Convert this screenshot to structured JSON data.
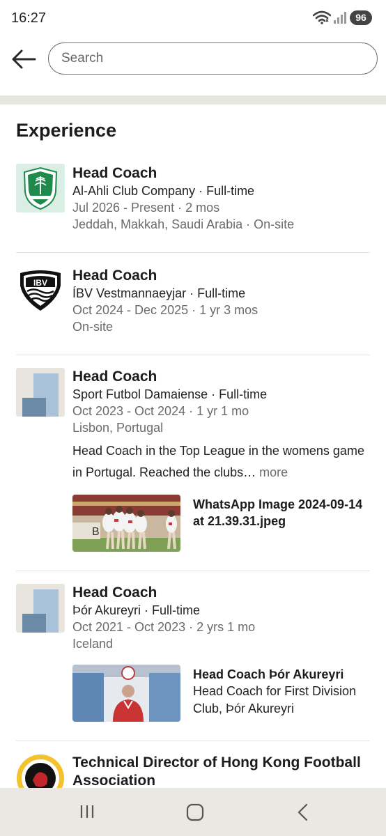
{
  "status": {
    "time": "16:27",
    "battery": "96"
  },
  "search": {
    "placeholder": "Search"
  },
  "section": {
    "title": "Experience"
  },
  "experiences": [
    {
      "role": "Head Coach",
      "company": "Al-Ahli Club Company · Full-time",
      "dates": "Jul 2026 - Present · 2 mos",
      "location": "Jeddah, Makkah, Saudi Arabia · On-site"
    },
    {
      "role": "Head Coach",
      "company": "ÍBV Vestmannaeyjar · Full-time",
      "dates": "Oct 2024 - Dec 2025 · 1 yr 3 mos",
      "location": "On-site"
    },
    {
      "role": "Head Coach",
      "company": "Sport Futbol Damaiense · Full-time",
      "dates": "Oct 2023 - Oct 2024 · 1 yr 1 mo",
      "location": "Lisbon, Portugal",
      "description": "Head Coach in the Top League in the womens game in Portugal. Reached the clubs…",
      "more": "more",
      "media": {
        "title": "WhatsApp Image 2024-09-14 at 21.39.31.jpeg"
      }
    },
    {
      "role": "Head Coach",
      "company": "Þór Akureyri · Full-time",
      "dates": "Oct 2021 - Oct 2023 · 2 yrs 1 mo",
      "location": "Iceland",
      "media": {
        "title": "Head Coach Þór Akureyri",
        "subtitle": "Head Coach for First Division Club, Þór Akureyri"
      }
    },
    {
      "role": "Technical Director of Hong Kong Football Association"
    }
  ],
  "icons": {
    "back": "arrow-left-icon",
    "wifi": "wifi-icon",
    "signal": "signal-icon",
    "nav_recents": "recents-icon",
    "nav_home": "home-icon",
    "nav_back": "chevron-left-icon"
  },
  "colors": {
    "divider_band": "#e9e5df",
    "nav_bar": "#ebe7e2",
    "muted_text": "#6b6b6b"
  }
}
